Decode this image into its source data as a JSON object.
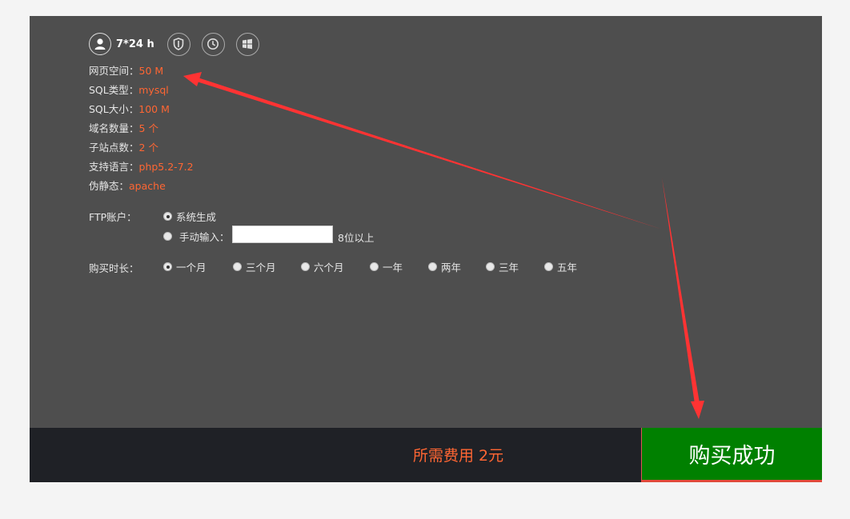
{
  "header": {
    "support_hours": "7*24 h",
    "icons": [
      "user-icon",
      "shield-icon",
      "clock-icon",
      "windows-icon"
    ]
  },
  "specs": [
    {
      "label": "网页空间：",
      "value": "50 M"
    },
    {
      "label": "SQL类型：",
      "value": "mysql"
    },
    {
      "label": "SQL大小：",
      "value": "100 M"
    },
    {
      "label": "域名数量：",
      "value": "5 个"
    },
    {
      "label": "子站点数：",
      "value": "2 个"
    },
    {
      "label": "支持语言：",
      "value": "php5.2-7.2"
    },
    {
      "label": "伪静态：",
      "value": "apache"
    }
  ],
  "ftp": {
    "label": "FTP账户：",
    "option_auto": "系统生成",
    "option_manual": "手动输入：",
    "input_value": "",
    "hint": "8位以上",
    "selected": "auto"
  },
  "duration": {
    "label": "购买时长：",
    "options": [
      "一个月",
      "三个月",
      "六个月",
      "一年",
      "两年",
      "三年",
      "五年"
    ],
    "selected": "一个月"
  },
  "footer": {
    "cost_text": "所需费用 2元",
    "buy_label": "购买成功"
  },
  "colors": {
    "accent": "#ff6633",
    "buy_button": "#008000",
    "panel": "#4e4e4e",
    "footer": "#1f2126",
    "annotation_arrow": "#ff3333"
  }
}
